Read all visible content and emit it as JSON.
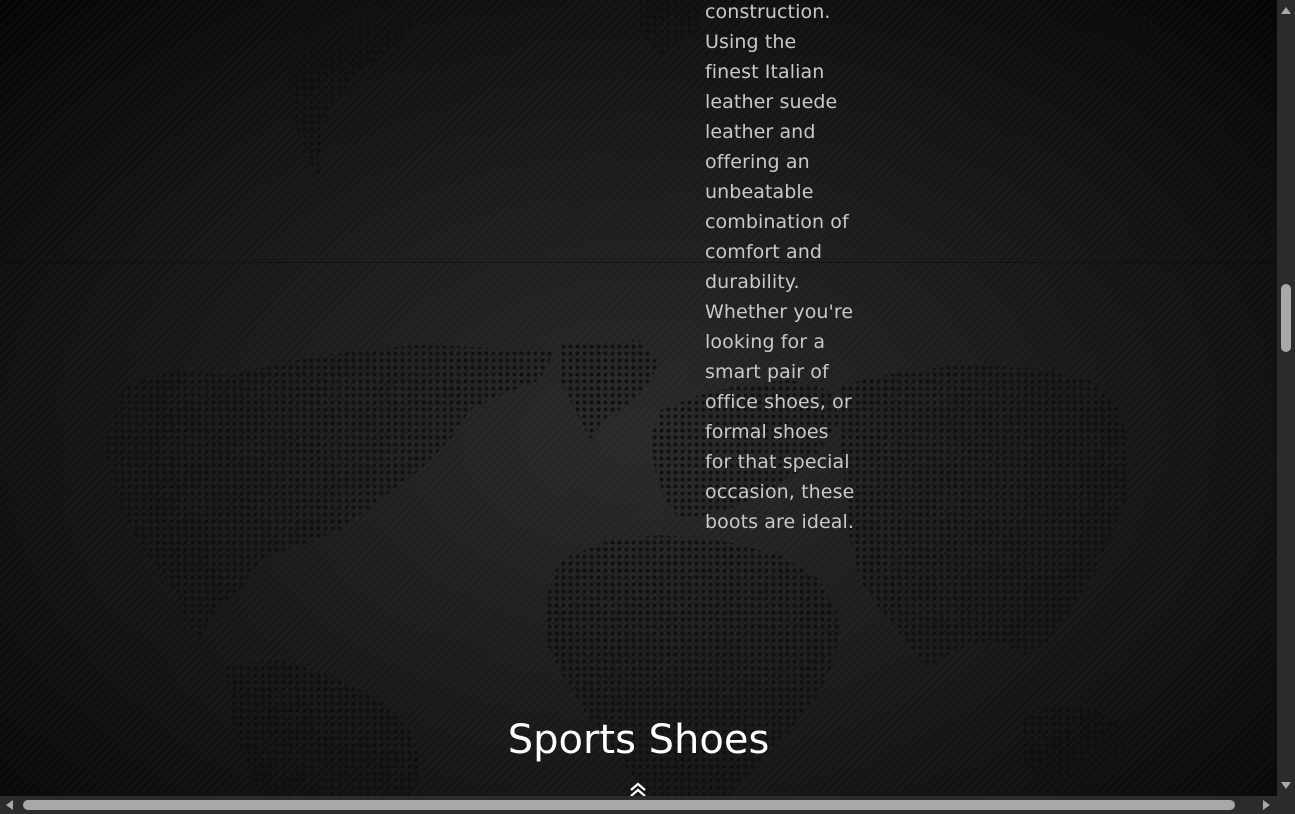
{
  "content": {
    "description": "construction. Using the finest Italian leather suede leather and offering an unbeatable combination of comfort and durability. Whether you're looking for a smart pair of office shoes, or formal shoes for that special occasion, these boots are ideal.",
    "section_title": "Sports Shoes"
  },
  "icons": {
    "scroll_top": "double-chevron-up-icon",
    "scroll_up": "triangle-up-icon",
    "scroll_down": "triangle-down-icon",
    "scroll_left": "triangle-left-icon",
    "scroll_right": "triangle-right-icon"
  },
  "colors": {
    "background": "#1b1b1b",
    "text": "#c9c9c9",
    "title": "#ffffff",
    "scrollbar_track": "#2b2b2b",
    "scrollbar_thumb": "#a8a8a8"
  }
}
